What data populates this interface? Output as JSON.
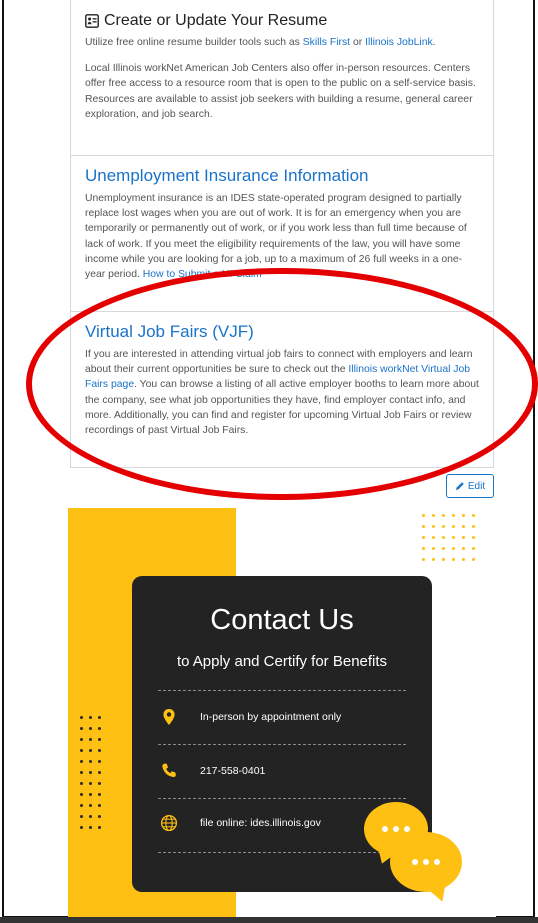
{
  "resume": {
    "title": "Create or Update Your Resume",
    "p1_prefix": "Utilize free online resume builder tools such as ",
    "p1_link1": "Skills First",
    "p1_mid": " or ",
    "p1_link2": "Illinois JobLink",
    "p1_suffix": ".",
    "p2": "Local Illinois workNet American Job Centers also offer in-person resources. Centers offer free access to a resource room that is open to the public on a self-service basis. Resources are available to assist job seekers with building a resume, general career exploration, and job search."
  },
  "ui": {
    "title": "Unemployment Insurance Information",
    "body": "Unemployment insurance is an IDES state-operated program designed to partially replace lost wages when you are out of work. It is for an emergency when you are temporarily or permanently out of work, or if you work less than full time because of lack of work. If you meet the eligibility requirements of the law, you will have some income while you are looking for a job, up to a maximum of 26 full weeks in a one-year period. ",
    "link": "How to Submit a UI Claim"
  },
  "vjf": {
    "title": "Virtual Job Fairs (VJF)",
    "p_prefix": "If you are interested in attending virtual job fairs to connect with employers and learn about their current opportunities be sure to check out the ",
    "p_link": "Illinois workNet Virtual Job Fairs page",
    "p_suffix": ". You can browse a listing of all active employer booths to learn more about the company, see what job opportunities they have, find employer contact info, and more. Additionally, you can find and register for upcoming Virtual Job Fairs or review recordings of past Virtual Job Fairs."
  },
  "edit_button": {
    "label": "Edit",
    "icon": "pencil-icon"
  },
  "contact": {
    "title": "Contact Us",
    "subtitle": "to Apply and Certify for Benefits",
    "rows": [
      {
        "icon": "location-pin-icon",
        "text": "In-person by appointment only"
      },
      {
        "icon": "phone-icon",
        "text": "217-558-0401"
      },
      {
        "icon": "globe-icon",
        "text": "file online: ides.illinois.gov"
      }
    ]
  },
  "colors": {
    "link_blue": "#1a73c9",
    "highlight_red": "#e40000",
    "flyer_yellow": "#fec013",
    "flyer_dark": "#232323"
  }
}
